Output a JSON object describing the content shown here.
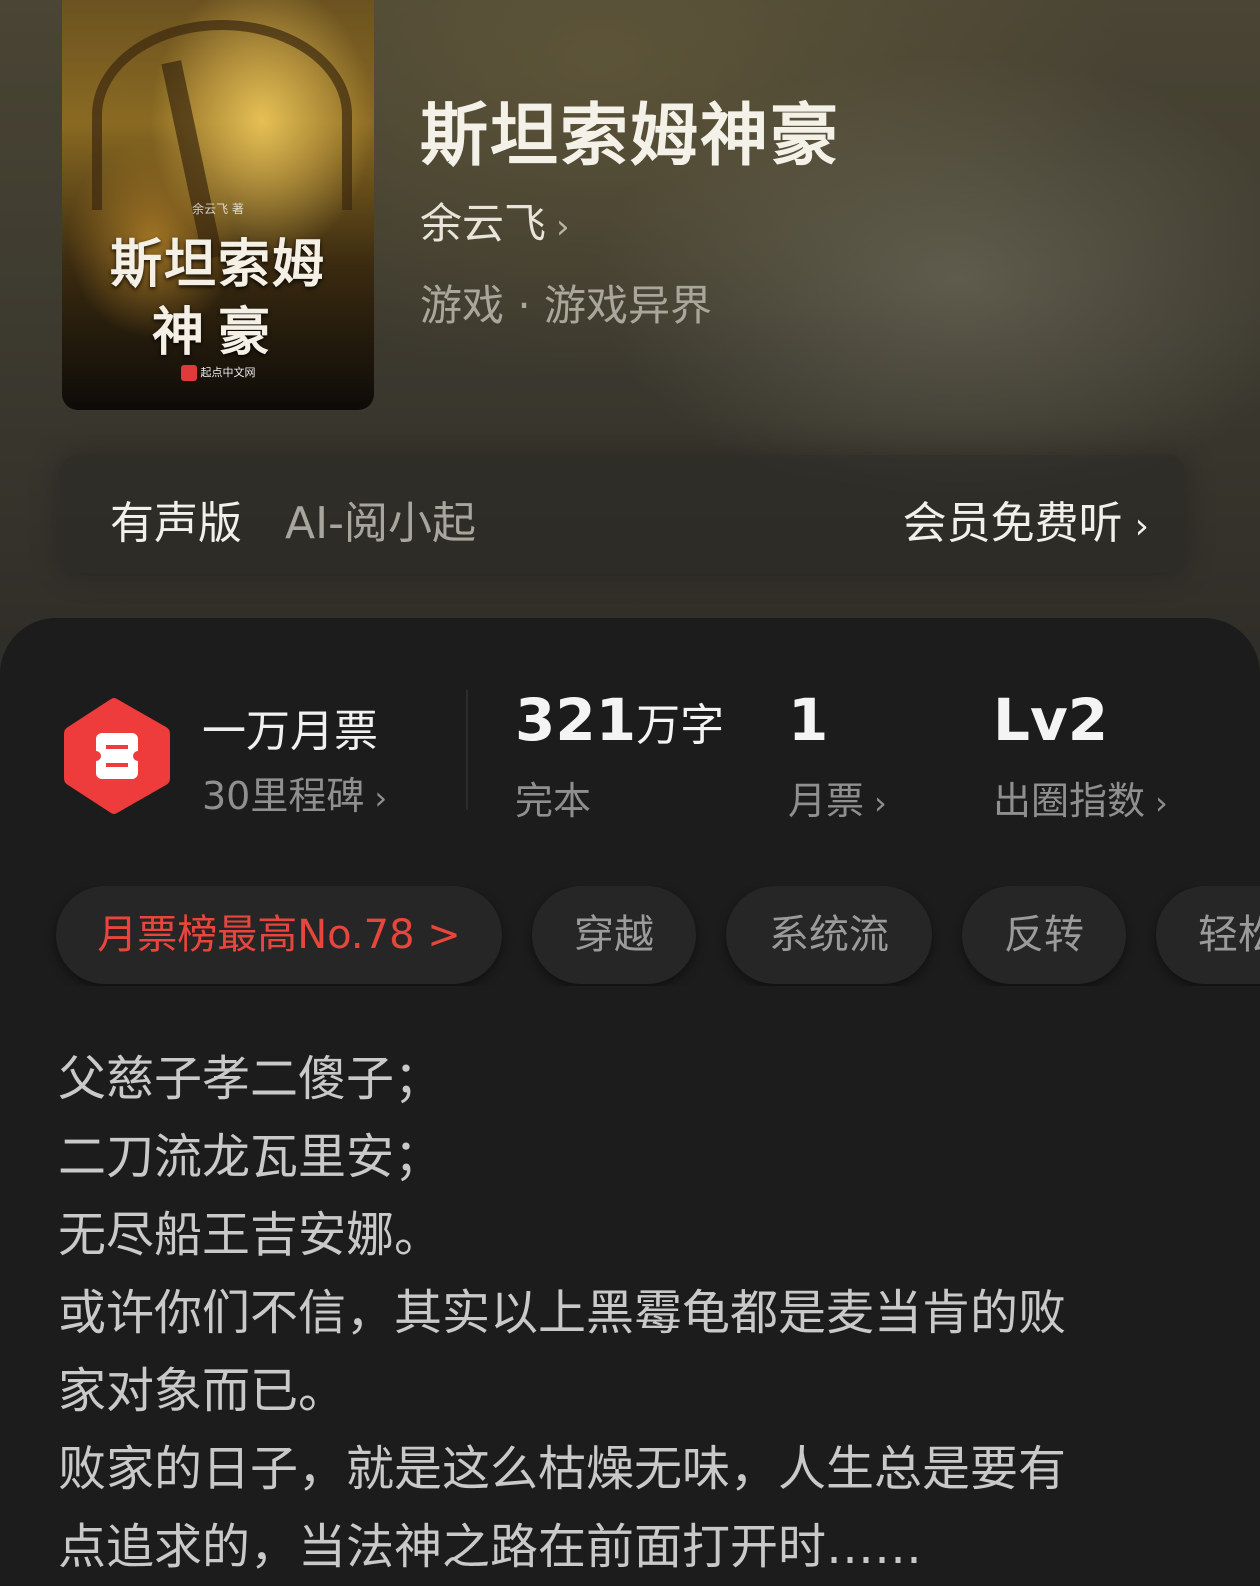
{
  "book": {
    "title": "斯坦索姆神豪",
    "author": "余云飞",
    "genre": "游戏 · 游戏异界",
    "cover": {
      "author_text": "余云飞 著",
      "title_line1": "斯坦索姆",
      "title_line2": "神豪",
      "publisher": "起点中文网"
    }
  },
  "audio": {
    "label": "有声版",
    "voice": "AI-阅小起",
    "cta": "会员免费听"
  },
  "stats": {
    "badge_title": "一万月票",
    "badge_sub": "30里程碑",
    "words_number": "321",
    "words_unit": "万字",
    "words_status": "完本",
    "monthly_votes_value": "1",
    "monthly_votes_label": "月票",
    "influence_value": "Lv2",
    "influence_label": "出圈指数"
  },
  "tags": [
    "月票榜最高No.78 >",
    "穿越",
    "系统流",
    "反转",
    "轻松"
  ],
  "synopsis": [
    "父慈子孝二傻子；",
    "二刀流龙瓦里安；",
    "无尽船王吉安娜。",
    "或许你们不信，其实以上黑霉龟都是麦当肯的败",
    "家对象而已。",
    "败家的日子，就是这么枯燥无味，人生总是要有",
    "点追求的，当法神之路在前面打开时……"
  ],
  "colors": {
    "accent_red": "#e8463c",
    "badge_red": "#ee3b3b",
    "sheet_bg": "#1c1c1c"
  },
  "icons": {
    "chevron": "›",
    "badge": "ticket-hexagon-icon"
  }
}
